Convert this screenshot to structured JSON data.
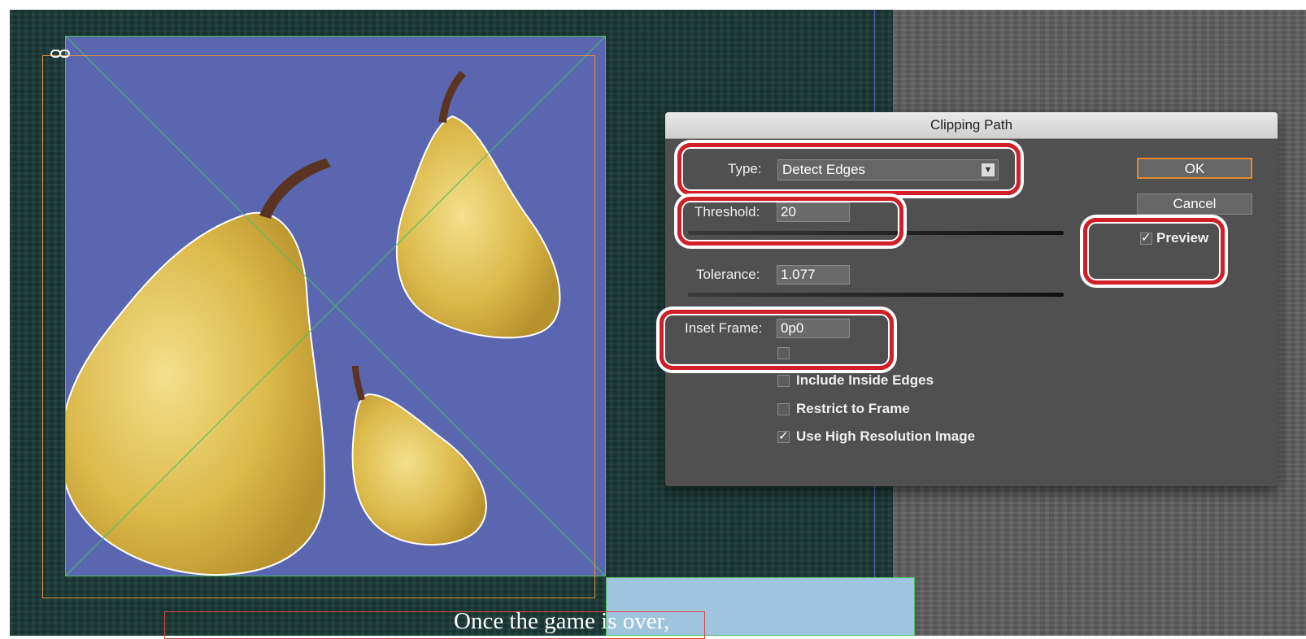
{
  "layout_caption": "Once the game is over,",
  "dialog": {
    "title": "Clipping Path",
    "type_label": "Type:",
    "type_value": "Detect Edges",
    "threshold_label": "Threshold:",
    "threshold_value": "20",
    "tolerance_label": "Tolerance:",
    "tolerance_value": "1.077",
    "inset_label": "Inset Frame:",
    "inset_value": "0p0",
    "include_inside_edges": "Include Inside Edges",
    "restrict_to_frame": "Restrict to Frame",
    "use_high_res": "Use High Resolution Image",
    "ok_label": "OK",
    "cancel_label": "Cancel",
    "preview_label": "Preview"
  },
  "states": {
    "preview_checked": true,
    "include_inside_edges_checked": false,
    "restrict_to_frame_checked": false,
    "use_high_res_checked": true
  },
  "colors": {
    "callout": "#d11f2a",
    "image_background": "#5a67b0",
    "pasteboard": "#5f5f5f",
    "ok_focus": "#e0872f"
  },
  "icons": [
    "link-icon",
    "dropdown-arrow-icon",
    "checkmark-icon"
  ]
}
